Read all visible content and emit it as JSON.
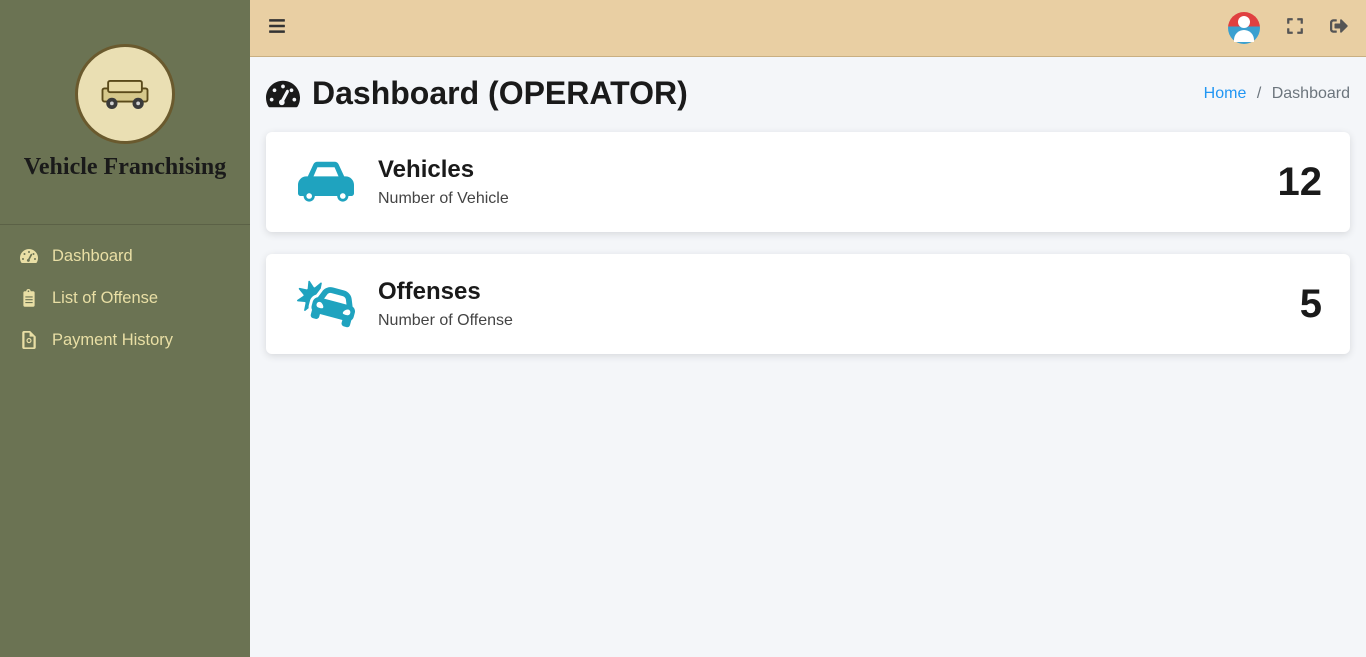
{
  "brand": {
    "name": "Vehicle Franchising"
  },
  "sidebar": {
    "items": [
      {
        "label": "Dashboard"
      },
      {
        "label": "List of Offense"
      },
      {
        "label": "Payment History"
      }
    ]
  },
  "header": {
    "title": "Dashboard (OPERATOR)"
  },
  "breadcrumb": {
    "home": "Home",
    "current": "Dashboard",
    "sep": "/"
  },
  "cards": [
    {
      "title": "Vehicles",
      "subtitle": "Number of Vehicle",
      "value": "12"
    },
    {
      "title": "Offenses",
      "subtitle": "Number of Offense",
      "value": "5"
    }
  ]
}
